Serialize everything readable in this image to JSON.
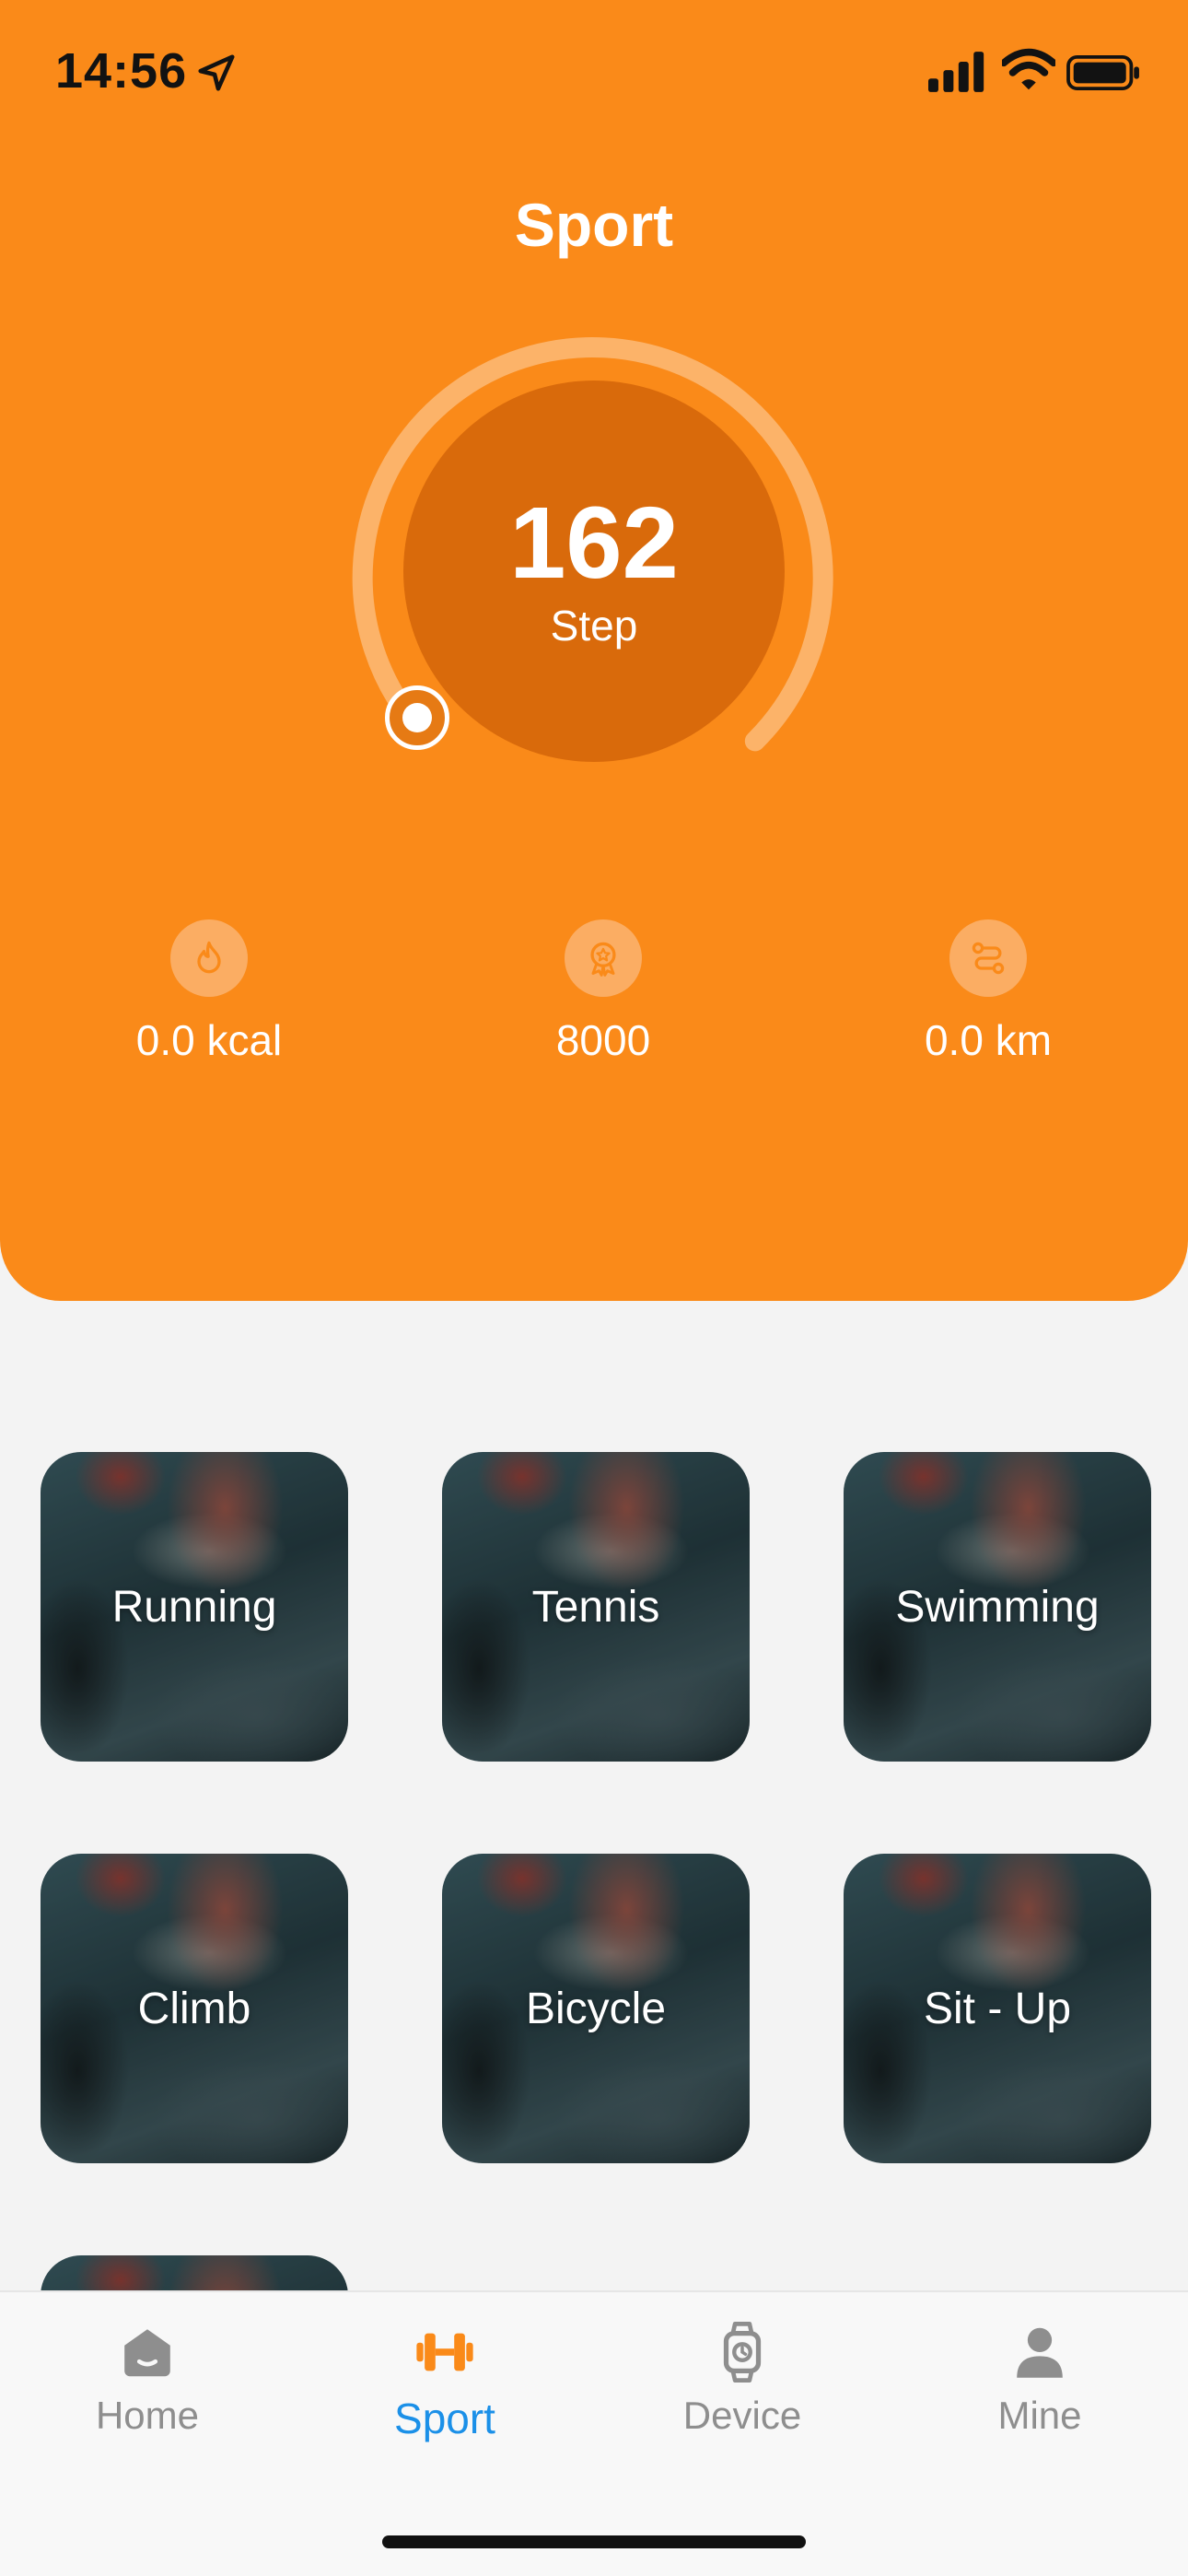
{
  "status_bar": {
    "time": "14:56",
    "icons": [
      "location-arrow-icon",
      "signal-icon",
      "wifi-icon",
      "battery-icon"
    ]
  },
  "header": {
    "title": "Sport"
  },
  "steps": {
    "value": "162",
    "label": "Step"
  },
  "stats": [
    {
      "icon": "flame-icon",
      "value": "0.0 kcal"
    },
    {
      "icon": "medal-icon",
      "value": "8000"
    },
    {
      "icon": "route-icon",
      "value": "0.0 km"
    }
  ],
  "sports": [
    {
      "label": "Running"
    },
    {
      "label": "Tennis"
    },
    {
      "label": "Swimming"
    },
    {
      "label": "Climb"
    },
    {
      "label": "Bicycle"
    },
    {
      "label": "Sit - Up"
    }
  ],
  "tab_bar": {
    "items": [
      {
        "label": "Home",
        "icon": "home-icon",
        "active": false
      },
      {
        "label": "Sport",
        "icon": "dumbbell-icon",
        "active": true
      },
      {
        "label": "Device",
        "icon": "watch-icon",
        "active": false
      },
      {
        "label": "Mine",
        "icon": "person-icon",
        "active": false
      }
    ]
  },
  "colors": {
    "brand_orange": "#fa8a19",
    "ring_inner": "#d96a0b",
    "active_tab": "#1b90e8",
    "inactive_tab": "#8e8e8e",
    "background": "#f3f3f3"
  }
}
